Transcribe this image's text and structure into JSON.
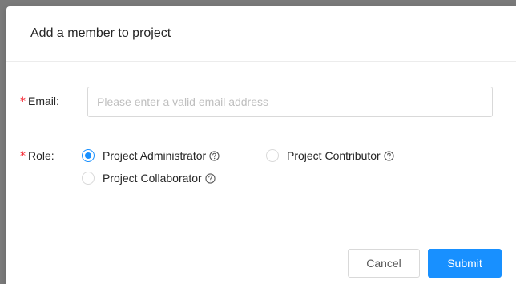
{
  "dialog": {
    "title": "Add a member to project"
  },
  "form": {
    "email": {
      "required_mark": "*",
      "label": "Email",
      "separator": ":",
      "value": "",
      "placeholder": "Please enter a valid email address"
    },
    "role": {
      "required_mark": "*",
      "label": "Role",
      "separator": ":",
      "selected": "Project Administrator",
      "options": [
        {
          "label": "Project Administrator",
          "checked": true
        },
        {
          "label": "Project Contributor",
          "checked": false
        },
        {
          "label": "Project Collaborator",
          "checked": false
        }
      ]
    }
  },
  "footer": {
    "cancel_label": "Cancel",
    "submit_label": "Submit"
  },
  "colors": {
    "accent": "#1890ff",
    "required": "#f5222d",
    "backdrop": "#7a7a7a"
  },
  "icons": {
    "help": "question-circle-icon"
  }
}
